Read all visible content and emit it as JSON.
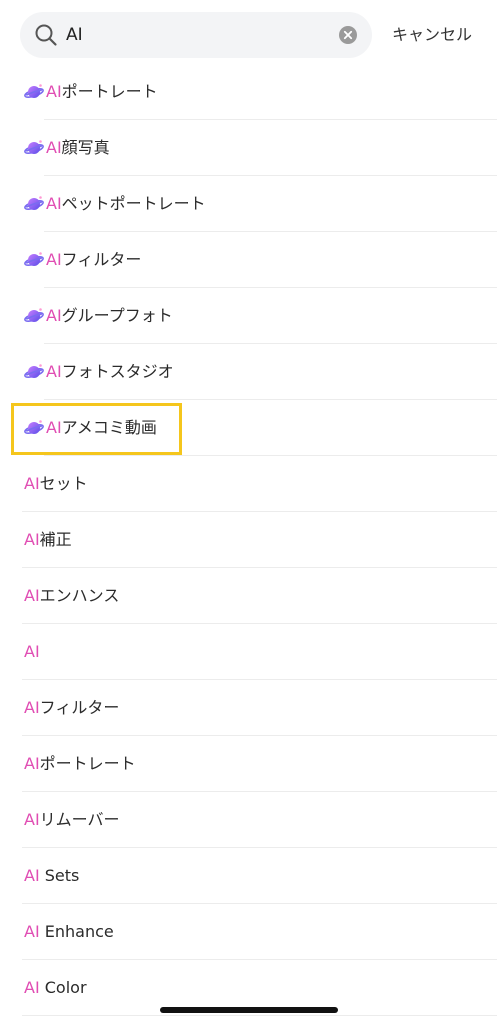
{
  "search": {
    "value": "AI",
    "cancel_label": "キャンセル"
  },
  "results": [
    {
      "prefix": "AI",
      "rest": "ポートレート",
      "icon": "planet-icon"
    },
    {
      "prefix": "AI",
      "rest": "顔写真",
      "icon": "planet-icon"
    },
    {
      "prefix": "AI",
      "rest": "ペットポートレート",
      "icon": "planet-icon"
    },
    {
      "prefix": "AI",
      "rest": "フィルター",
      "icon": "planet-icon"
    },
    {
      "prefix": "AI",
      "rest": "グループフォト",
      "icon": "planet-icon"
    },
    {
      "prefix": "AI",
      "rest": "フォトスタジオ",
      "icon": "planet-icon"
    },
    {
      "prefix": "AI",
      "rest": "アメコミ動画",
      "icon": "planet-icon",
      "highlighted": true
    },
    {
      "prefix": "AI",
      "rest": "セット"
    },
    {
      "prefix": "AI",
      "rest": "補正"
    },
    {
      "prefix": "AI",
      "rest": "エンハンス"
    },
    {
      "prefix": "AI",
      "rest": ""
    },
    {
      "prefix": "AI",
      "rest": "フィルター"
    },
    {
      "prefix": "AI",
      "rest": "ポートレート"
    },
    {
      "prefix": "AI",
      "rest": "リムーバー"
    },
    {
      "prefix": "AI",
      "rest": " Sets"
    },
    {
      "prefix": "AI",
      "rest": " Enhance"
    },
    {
      "prefix": "AI",
      "rest": " Color"
    }
  ],
  "colors": {
    "accent": "#e04db3",
    "highlight_border": "#f5c61c",
    "search_bg": "#f3f4f6"
  }
}
